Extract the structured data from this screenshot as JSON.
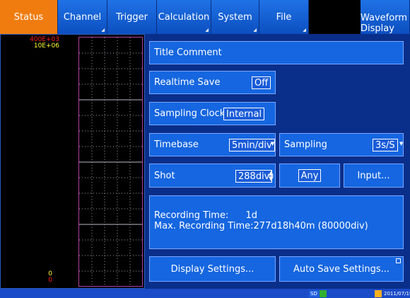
{
  "tabs": [
    {
      "label": "Status",
      "active": true,
      "has_arrow": false
    },
    {
      "label": "Channel",
      "active": false,
      "has_arrow": true
    },
    {
      "label": "Trigger",
      "active": false,
      "has_arrow": false
    },
    {
      "label": "Calculation",
      "active": false,
      "has_arrow": true
    },
    {
      "label": "System",
      "active": false,
      "has_arrow": true
    },
    {
      "label": "File",
      "active": false,
      "has_arrow": true
    },
    {
      "label": "",
      "active": false,
      "has_arrow": false
    },
    {
      "label_line1": "Waveform",
      "label_line2": "Display"
    }
  ],
  "waveform": {
    "scale_top_1": "400E+03",
    "scale_top_2": "10E+06",
    "scale_bot_1": "0",
    "scale_bot_2": "0",
    "colors": {
      "scale1": "#ff2020",
      "scale2": "#ffff30",
      "grid": "#9a9aa8",
      "border": "#b040a0"
    }
  },
  "panel": {
    "title_comment": "Title Comment",
    "realtime_save_label": "Realtime Save",
    "realtime_save_value": "Off",
    "sampling_clock_label": "Sampling Clock",
    "sampling_clock_value": "Internal",
    "timebase_label": "Timebase",
    "timebase_value": "5min/div",
    "sampling_label": "Sampling",
    "sampling_value": "3s/S",
    "shot_label": "Shot",
    "shot_value": "288div",
    "any_label": "Any",
    "input_label": "Input...",
    "recording_time_label": "Recording Time:",
    "recording_time_value": "1d",
    "max_recording_label": "Max. Recording Time:",
    "max_recording_value": "277d18h40m (80000div)",
    "display_settings": "Display Settings...",
    "auto_save_settings": "Auto Save Settings..."
  },
  "statusbar": {
    "sd_label": "SD",
    "date": "2011/07/19"
  },
  "colors": {
    "accent_tab": "#f07c10",
    "tab_blue": "#1566e0",
    "panel_bg": "#0a2f8a"
  }
}
